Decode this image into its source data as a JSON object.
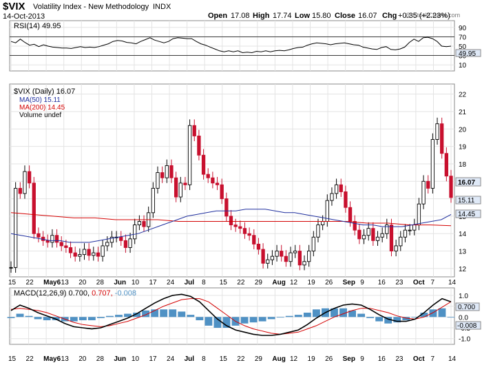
{
  "header": {
    "symbol": "$VIX",
    "name": "Volatility Index - New Methodology",
    "exchange": "INDX",
    "date": "14-Oct-2013",
    "watermark": "@ StockCharts.com",
    "quote": {
      "open_label": "Open",
      "open": "17.08",
      "high_label": "High",
      "high": "17.74",
      "low_label": "Low",
      "low": "15.80",
      "close_label": "Close",
      "close": "16.07",
      "chg_label": "Chg",
      "chg": "+0.35 (+2.23%)"
    }
  },
  "rsi_panel": {
    "label": "RSI(14) 49.95",
    "value_badge": "49.95",
    "ticks": [
      "90",
      "70",
      "50",
      "30",
      "10"
    ]
  },
  "price_panel": {
    "legend": [
      "$VIX (Daily) 16.07",
      "MA(50) 15.11",
      "MA(200) 14.45",
      "Volume undef"
    ],
    "badges": {
      "close": "16.07",
      "ma50": "15.11",
      "ma200": "14.45"
    },
    "y_ticks": [
      "22",
      "21",
      "20",
      "19",
      "18",
      "17",
      "16",
      "15",
      "14",
      "13",
      "12"
    ]
  },
  "macd_panel": {
    "label_prefix": "MACD(12,26,9)",
    "macd": "0.700,",
    "signal": "0.707,",
    "hist": "-0.008",
    "badges": {
      "macd": "0.700",
      "hist": "-0.008"
    },
    "y_ticks": [
      "1.0",
      "0.5",
      "0.0",
      "-0.5",
      "-1.0"
    ]
  },
  "x_axis": {
    "labels": [
      "15",
      "22",
      "May6",
      "13",
      "20",
      "28",
      "Jun",
      "10",
      "17",
      "24",
      "Jul",
      "8",
      "15",
      "22",
      "29",
      "Aug",
      "12",
      "19",
      "26",
      "Sep",
      "9",
      "16",
      "23",
      "Oct",
      "7",
      "14"
    ]
  },
  "colors": {
    "up": "#000000",
    "down": "#c8102e",
    "ma50": "#1f2f9e",
    "ma200": "#d40000",
    "rsi_line": "#000000",
    "macd_line": "#000000",
    "signal_line": "#d40000",
    "histogram": "#4f91c4",
    "grid": "#e3e3e3",
    "badge": "#dfe9f7"
  },
  "chart_data": [
    {
      "type": "line",
      "title": "RSI(14)",
      "ylim": [
        0,
        100
      ],
      "ref_lines": [
        70,
        30
      ],
      "values": [
        60,
        57,
        65,
        58,
        52,
        54,
        49,
        53,
        50,
        48,
        47,
        46,
        46,
        45,
        47,
        49,
        47,
        48,
        47,
        49,
        52,
        55,
        60,
        62,
        61,
        58,
        57,
        55,
        60,
        64,
        68,
        63,
        60,
        57,
        60,
        66,
        68,
        67,
        66,
        66,
        60,
        55,
        52,
        48,
        44,
        40,
        38,
        40,
        38,
        40,
        36,
        37,
        36,
        39,
        38,
        40,
        38,
        40,
        41,
        40,
        42,
        45,
        47,
        48,
        52,
        55,
        57,
        56,
        55,
        53,
        55,
        56,
        57,
        55,
        53,
        52,
        48,
        46,
        44,
        43,
        47,
        49,
        43,
        42,
        44,
        48,
        58,
        65,
        60,
        68,
        69,
        66,
        60,
        50,
        49,
        50
      ]
    },
    {
      "type": "candlestick",
      "title": "$VIX (Daily) 16.07",
      "ylim": [
        11.6,
        22.5
      ],
      "x": [
        "Apr 15",
        "Apr 22",
        "May 6",
        "May 13",
        "May 20",
        "May 28",
        "Jun 3",
        "Jun 10",
        "Jun 17",
        "Jun 24",
        "Jul 1",
        "Jul 8",
        "Jul 15",
        "Jul 22",
        "Jul 29",
        "Aug 5",
        "Aug 12",
        "Aug 19",
        "Aug 26",
        "Sep 3",
        "Sep 9",
        "Sep 16",
        "Sep 23",
        "Sep 30",
        "Oct 7",
        "Oct 14"
      ],
      "close": [
        12.06,
        16.6,
        16.3,
        17.56,
        16.9,
        14.0,
        13.8,
        13.6,
        13.5,
        13.9,
        13.5,
        13.3,
        13.2,
        12.9,
        12.7,
        12.8,
        13.1,
        12.75,
        12.9,
        12.7,
        13.3,
        13.5,
        13.8,
        13.8,
        13.6,
        13.2,
        13.7,
        14.5,
        14.7,
        14.4,
        15.2,
        16.6,
        17.5,
        17.2,
        17.9,
        17.2,
        16.1,
        16.9,
        16.8,
        20.2,
        19.6,
        18.5,
        17.4,
        17.2,
        16.9,
        16.8,
        16.0,
        15.0,
        14.5,
        14.4,
        14.3,
        14.0,
        13.9,
        13.4,
        13.1,
        12.3,
        12.5,
        12.7,
        13.0,
        12.7,
        12.4,
        12.9,
        13.0,
        12.2,
        12.4,
        13.0,
        13.8,
        14.5,
        14.7,
        15.9,
        16.3,
        16.8,
        16.4,
        15.5,
        14.7,
        14.2,
        13.7,
        13.9,
        14.3,
        13.6,
        13.8,
        14.0,
        14.5,
        13.0,
        13.3,
        13.8,
        14.2,
        14.2,
        14.5,
        15.7,
        17.0,
        16.6,
        19.4,
        20.3,
        18.6,
        17.3,
        16.07
      ],
      "ma50": [
        14.0,
        13.9,
        13.8,
        13.7,
        13.6,
        13.6,
        13.5,
        13.5,
        13.5,
        13.6,
        13.7,
        13.8,
        13.9,
        14.0,
        14.2,
        14.4,
        14.6,
        14.8,
        15.0,
        15.1,
        15.2,
        15.3,
        15.3,
        15.3,
        15.4,
        15.4,
        15.4,
        15.3,
        15.2,
        15.2,
        15.1,
        15.0,
        14.9,
        14.8,
        14.7,
        14.6,
        14.5,
        14.5,
        14.4,
        14.4,
        14.4,
        14.5,
        14.6,
        14.7,
        14.8,
        15.1
      ],
      "ma200": [
        15.2,
        15.1,
        15.0,
        14.9,
        14.9,
        14.8,
        14.8,
        14.8,
        14.7,
        14.7,
        14.7,
        14.7,
        14.7,
        14.7,
        14.7,
        14.7,
        14.7,
        14.6,
        14.6,
        14.5,
        14.5,
        14.45
      ]
    },
    {
      "type": "bar",
      "title": "MACD(12,26,9)",
      "ylim": [
        -1.2,
        1.25
      ],
      "macd": [
        0.3,
        0.55,
        0.4,
        0.2,
        0.05,
        -0.1,
        -0.3,
        -0.45,
        -0.5,
        -0.55,
        -0.5,
        -0.35,
        -0.2,
        -0.05,
        0.15,
        0.4,
        0.65,
        0.85,
        1.0,
        1.05,
        0.95,
        0.7,
        0.3,
        -0.1,
        -0.4,
        -0.6,
        -0.7,
        -0.8,
        -0.85,
        -0.85,
        -0.8,
        -0.7,
        -0.6,
        -0.35,
        -0.05,
        0.2,
        0.4,
        0.55,
        0.6,
        0.55,
        0.35,
        0.1,
        -0.1,
        -0.2,
        -0.2,
        -0.1,
        0.2,
        0.55,
        0.85,
        0.7
      ],
      "signal": [
        0.35,
        0.4,
        0.35,
        0.3,
        0.2,
        0.05,
        -0.1,
        -0.25,
        -0.35,
        -0.4,
        -0.45,
        -0.4,
        -0.3,
        -0.2,
        -0.05,
        0.1,
        0.3,
        0.5,
        0.65,
        0.8,
        0.85,
        0.85,
        0.7,
        0.4,
        0.1,
        -0.2,
        -0.4,
        -0.55,
        -0.65,
        -0.75,
        -0.8,
        -0.75,
        -0.7,
        -0.55,
        -0.4,
        -0.2,
        0.0,
        0.15,
        0.3,
        0.4,
        0.4,
        0.3,
        0.2,
        0.05,
        -0.05,
        -0.1,
        0.0,
        0.2,
        0.45,
        0.707
      ],
      "histogram": [
        -0.05,
        0.15,
        0.05,
        -0.1,
        -0.15,
        -0.15,
        -0.2,
        -0.2,
        -0.15,
        -0.15,
        -0.05,
        0.05,
        0.1,
        0.15,
        0.2,
        0.3,
        0.35,
        0.35,
        0.35,
        0.25,
        0.1,
        -0.15,
        -0.4,
        -0.5,
        -0.5,
        -0.4,
        -0.3,
        -0.25,
        -0.2,
        -0.1,
        0.0,
        0.05,
        0.1,
        0.2,
        0.35,
        0.4,
        0.4,
        0.4,
        0.3,
        0.15,
        -0.05,
        -0.2,
        -0.3,
        -0.25,
        -0.15,
        0.0,
        0.2,
        0.35,
        0.4,
        -0.008
      ]
    }
  ]
}
